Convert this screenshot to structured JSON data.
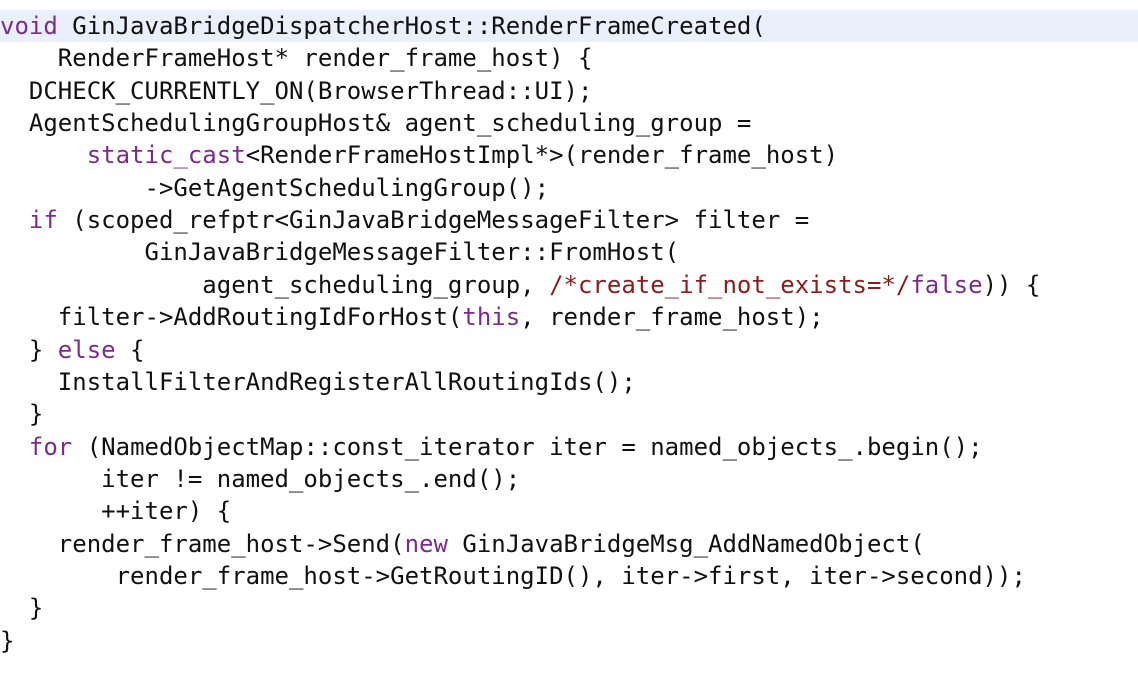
{
  "code": {
    "lines": [
      [
        {
          "t": "void",
          "c": "kw"
        },
        {
          "t": " GinJavaBridgeDispatcherHost::RenderFrameCreated(",
          "c": "pl"
        }
      ],
      [
        {
          "t": "    RenderFrameHost* render_frame_host) {",
          "c": "pl"
        }
      ],
      [
        {
          "t": "  DCHECK_CURRENTLY_ON(BrowserThread::UI);",
          "c": "pl"
        }
      ],
      [
        {
          "t": "  AgentSchedulingGroupHost& agent_scheduling_group =",
          "c": "pl"
        }
      ],
      [
        {
          "t": "      ",
          "c": "pl"
        },
        {
          "t": "static_cast",
          "c": "kw"
        },
        {
          "t": "<RenderFrameHostImpl*>(render_frame_host)",
          "c": "pl"
        }
      ],
      [
        {
          "t": "          ->GetAgentSchedulingGroup();",
          "c": "pl"
        }
      ],
      [
        {
          "t": "  ",
          "c": "pl"
        },
        {
          "t": "if",
          "c": "kw"
        },
        {
          "t": " (scoped_refptr<GinJavaBridgeMessageFilter> filter =",
          "c": "pl"
        }
      ],
      [
        {
          "t": "          GinJavaBridgeMessageFilter::FromHost(",
          "c": "pl"
        }
      ],
      [
        {
          "t": "              agent_scheduling_group, ",
          "c": "pl"
        },
        {
          "t": "/*create_if_not_exists=*/",
          "c": "cm"
        },
        {
          "t": "false",
          "c": "kw"
        },
        {
          "t": ")) {",
          "c": "pl"
        }
      ],
      [
        {
          "t": "    filter->AddRoutingIdForHost(",
          "c": "pl"
        },
        {
          "t": "this",
          "c": "kw"
        },
        {
          "t": ", render_frame_host);",
          "c": "pl"
        }
      ],
      [
        {
          "t": "  } ",
          "c": "pl"
        },
        {
          "t": "else",
          "c": "kw"
        },
        {
          "t": " {",
          "c": "pl"
        }
      ],
      [
        {
          "t": "    InstallFilterAndRegisterAllRoutingIds();",
          "c": "pl"
        }
      ],
      [
        {
          "t": "  }",
          "c": "pl"
        }
      ],
      [
        {
          "t": "  ",
          "c": "pl"
        },
        {
          "t": "for",
          "c": "kw"
        },
        {
          "t": " (NamedObjectMap::const_iterator iter = named_objects_.begin();",
          "c": "pl"
        }
      ],
      [
        {
          "t": "       iter != named_objects_.end();",
          "c": "pl"
        }
      ],
      [
        {
          "t": "       ++iter) {",
          "c": "pl"
        }
      ],
      [
        {
          "t": "    render_frame_host->Send(",
          "c": "pl"
        },
        {
          "t": "new",
          "c": "kw"
        },
        {
          "t": " GinJavaBridgeMsg_AddNamedObject(",
          "c": "pl"
        }
      ],
      [
        {
          "t": "        render_frame_host->GetRoutingID(), iter->first, iter->second));",
          "c": "pl"
        }
      ],
      [
        {
          "t": "  }",
          "c": "pl"
        }
      ],
      [
        {
          "t": "}",
          "c": "pl"
        }
      ]
    ],
    "highlighted_line": 0,
    "colors": {
      "keyword": "#7b2b8c",
      "comment": "#8a1c1c",
      "text": "#111111",
      "highlight_bg": "#eaf0fb",
      "background": "#ffffff"
    }
  }
}
